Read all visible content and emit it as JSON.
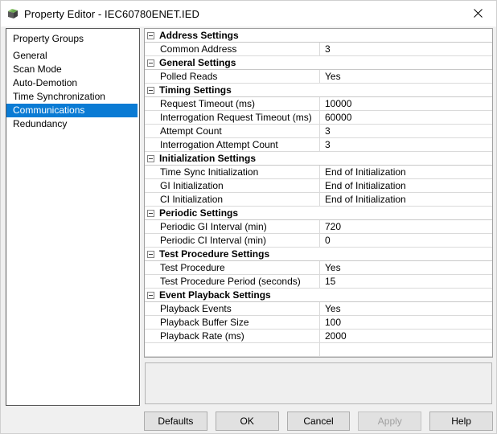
{
  "window": {
    "title": "Property Editor - IEC60780ENET.IED",
    "icon": "device-cube-icon",
    "close_label": "✕"
  },
  "sidebar": {
    "header": "Property Groups",
    "items": [
      {
        "label": "General",
        "selected": false
      },
      {
        "label": "Scan Mode",
        "selected": false
      },
      {
        "label": "Auto-Demotion",
        "selected": false
      },
      {
        "label": "Time Synchronization",
        "selected": false
      },
      {
        "label": "Communications",
        "selected": true
      },
      {
        "label": "Redundancy",
        "selected": false
      }
    ],
    "selected_color": "#0a7bd4"
  },
  "grid": {
    "rows": [
      {
        "type": "category",
        "label": "Address Settings"
      },
      {
        "type": "property",
        "name": "Common Address",
        "value": "3"
      },
      {
        "type": "category",
        "label": "General Settings"
      },
      {
        "type": "property",
        "name": "Polled Reads",
        "value": "Yes"
      },
      {
        "type": "category",
        "label": "Timing Settings"
      },
      {
        "type": "property",
        "name": "Request Timeout (ms)",
        "value": "10000"
      },
      {
        "type": "property",
        "name": "Interrogation Request Timeout (ms)",
        "value": "60000"
      },
      {
        "type": "property",
        "name": "Attempt Count",
        "value": "3"
      },
      {
        "type": "property",
        "name": "Interrogation Attempt Count",
        "value": "3"
      },
      {
        "type": "category",
        "label": "Initialization Settings"
      },
      {
        "type": "property",
        "name": "Time Sync Initialization",
        "value": "End of Initialization"
      },
      {
        "type": "property",
        "name": "GI Initialization",
        "value": "End of Initialization"
      },
      {
        "type": "property",
        "name": "CI Initialization",
        "value": "End of Initialization"
      },
      {
        "type": "category",
        "label": "Periodic Settings"
      },
      {
        "type": "property",
        "name": "Periodic GI Interval (min)",
        "value": "720"
      },
      {
        "type": "property",
        "name": "Periodic CI Interval (min)",
        "value": "0"
      },
      {
        "type": "category",
        "label": "Test Procedure Settings"
      },
      {
        "type": "property",
        "name": "Test Procedure",
        "value": "Yes"
      },
      {
        "type": "property",
        "name": "Test Procedure Period (seconds)",
        "value": "15"
      },
      {
        "type": "category",
        "label": "Event Playback Settings"
      },
      {
        "type": "property",
        "name": "Playback Events",
        "value": "Yes"
      },
      {
        "type": "property",
        "name": "Playback Buffer Size",
        "value": "100"
      },
      {
        "type": "property",
        "name": "Playback Rate (ms)",
        "value": "2000"
      },
      {
        "type": "blank",
        "name": "",
        "value": ""
      }
    ]
  },
  "description": {
    "text": ""
  },
  "buttons": [
    {
      "label": "Defaults",
      "name": "defaults-button",
      "disabled": false
    },
    {
      "label": "OK",
      "name": "ok-button",
      "disabled": false
    },
    {
      "label": "Cancel",
      "name": "cancel-button",
      "disabled": false
    },
    {
      "label": "Apply",
      "name": "apply-button",
      "disabled": true
    },
    {
      "label": "Help",
      "name": "help-button",
      "disabled": false
    }
  ]
}
